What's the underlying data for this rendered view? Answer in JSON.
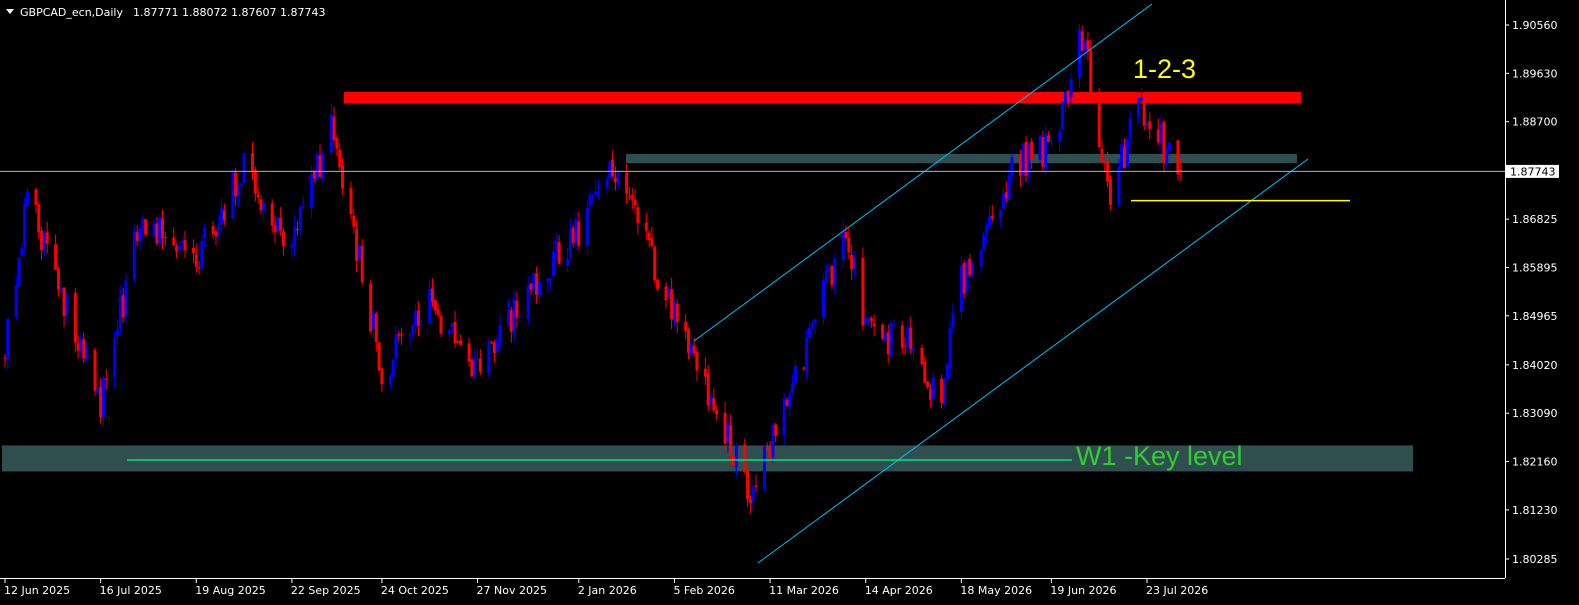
{
  "chart_data": {
    "type": "candlestick",
    "title": "GBPCAD_ecn,Daily",
    "ohlc_header": "1.87771 1.88072 1.87607 1.87743",
    "current_price": 1.87743,
    "current_price_label": "1.87743",
    "ylim": [
      1.8,
      1.909
    ],
    "price_ticks": [
      "1.90560",
      "1.89630",
      "1.88700",
      "1.86825",
      "1.85895",
      "1.84965",
      "1.84020",
      "1.83090",
      "1.82160",
      "1.81230",
      "1.80285"
    ],
    "date_ticks": [
      "12 Jun 2025",
      "16 Jul 2025",
      "19 Aug 2025",
      "22 Sep 2025",
      "24 Oct 2025",
      "27 Nov 2025",
      "2 Jan 2026",
      "5 Feb 2026",
      "11 Mar 2026",
      "14 Apr 2026",
      "18 May 2026",
      "19 Jun 2026",
      "23 Jul 2026"
    ],
    "up_color": "#0000ff",
    "down_color": "#ff0000",
    "close_path": [
      {
        "date": "12 Jun 2025",
        "close": 1.842
      },
      {
        "date": "20 Jun 2025",
        "close": 1.872
      },
      {
        "date": "1 Jul 2025",
        "close": 1.856
      },
      {
        "date": "16 Jul 2025",
        "close": 1.832
      },
      {
        "date": "30 Jul 2025",
        "close": 1.868
      },
      {
        "date": "19 Aug 2025",
        "close": 1.86
      },
      {
        "date": "5 Sep 2025",
        "close": 1.878
      },
      {
        "date": "22 Sep 2025",
        "close": 1.864
      },
      {
        "date": "6 Oct 2025",
        "close": 1.886
      },
      {
        "date": "24 Oct 2025",
        "close": 1.839
      },
      {
        "date": "10 Nov 2025",
        "close": 1.852
      },
      {
        "date": "27 Nov 2025",
        "close": 1.84
      },
      {
        "date": "15 Dec 2025",
        "close": 1.854
      },
      {
        "date": "2 Jan 2026",
        "close": 1.866
      },
      {
        "date": "15 Jan 2026",
        "close": 1.878
      },
      {
        "date": "5 Feb 2026",
        "close": 1.85
      },
      {
        "date": "25 Feb 2026",
        "close": 1.826
      },
      {
        "date": "4 Mar 2026",
        "close": 1.813
      },
      {
        "date": "11 Mar 2026",
        "close": 1.825
      },
      {
        "date": "25 Mar 2026",
        "close": 1.844
      },
      {
        "date": "7 Apr 2026",
        "close": 1.868
      },
      {
        "date": "14 Apr 2026",
        "close": 1.846
      },
      {
        "date": "1 May 2026",
        "close": 1.845
      },
      {
        "date": "10 May 2026",
        "close": 1.832
      },
      {
        "date": "18 May 2026",
        "close": 1.856
      },
      {
        "date": "5 Jun 2026",
        "close": 1.878
      },
      {
        "date": "19 Jun 2026",
        "close": 1.882
      },
      {
        "date": "30 Jun 2026",
        "close": 1.904
      },
      {
        "date": "10 Jul 2026",
        "close": 1.872
      },
      {
        "date": "20 Jul 2026",
        "close": 1.89
      },
      {
        "date": "4 Aug 2026",
        "close": 1.8774
      }
    ],
    "annotations": [
      {
        "type": "zone",
        "label": "W1 -Key level",
        "from": 1.8197,
        "to": 1.8247,
        "color": "#2f4f4f"
      },
      {
        "type": "zone",
        "from": 1.879,
        "to": 1.8808,
        "color": "#2f4f4f"
      },
      {
        "type": "zone",
        "from": 1.8905,
        "to": 1.8927,
        "color": "#ff0000"
      },
      {
        "type": "text",
        "label": "1-2-3",
        "color": "#ffff00"
      },
      {
        "type": "hline",
        "value": 1.8718,
        "color": "#ffff00"
      },
      {
        "type": "hline",
        "value": 1.8219,
        "color": "#00ff7f"
      },
      {
        "type": "channel",
        "color": "#00bfff"
      }
    ]
  }
}
